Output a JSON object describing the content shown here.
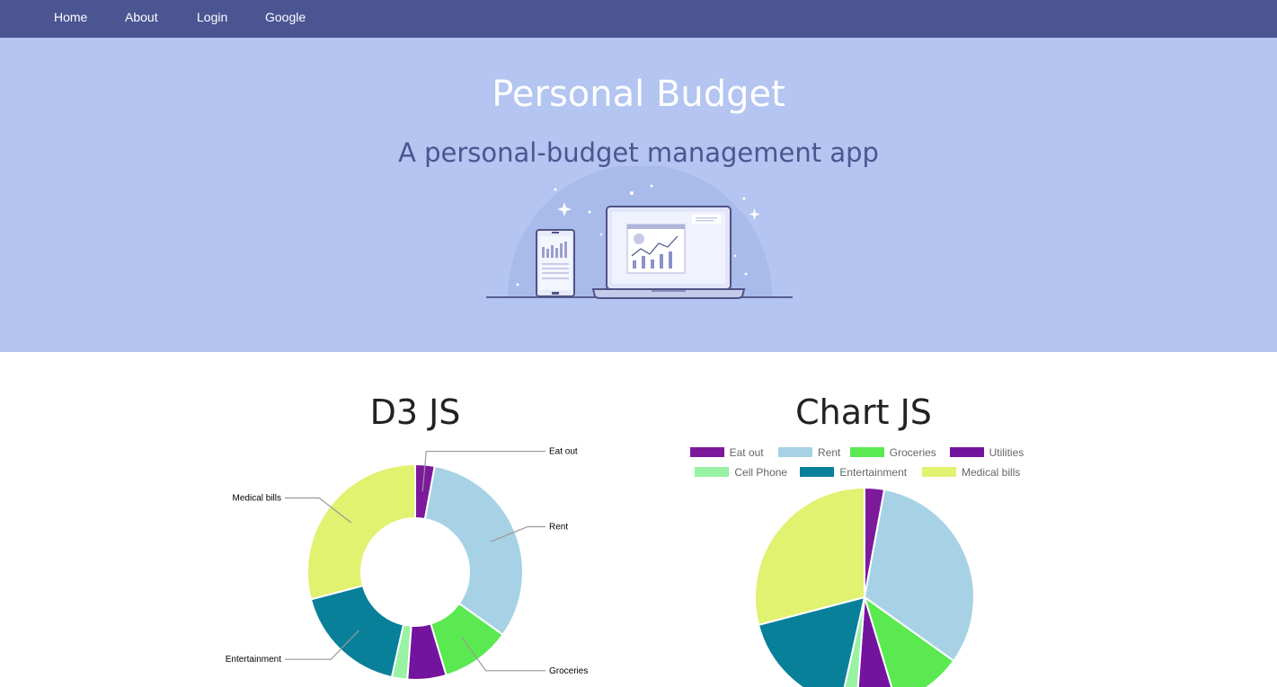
{
  "nav": {
    "items": [
      "Home",
      "About",
      "Login",
      "Google"
    ]
  },
  "hero": {
    "title": "Personal Budget",
    "subtitle": "A personal-budget management app",
    "illustration_icon": "devices-chart-illustration"
  },
  "colors": {
    "nav_bg": "#4b5592",
    "hero_bg": "#b3c5f0",
    "eat_out": "#7c1a9b",
    "rent": "#a7d2e6",
    "groceries": "#5ae950",
    "utilities": "#73149f",
    "cell_phone": "#97f2a4",
    "entertainment": "#08809a",
    "medical_bills": "#e1f170"
  },
  "d3_section": {
    "title": "D3 JS"
  },
  "chartjs_section": {
    "title": "Chart JS"
  },
  "chart_data": [
    {
      "type": "pie",
      "variant": "donut",
      "categories": [
        "Eat out",
        "Rent",
        "Groceries",
        "Utilities",
        "Cell Phone",
        "Entertainment",
        "Medical bills"
      ],
      "values": [
        25,
        275,
        90,
        50,
        20,
        150,
        250
      ],
      "visible_labels": [
        "Eat out",
        "Rent",
        "Groceries",
        "Entertainment",
        "Medical bills"
      ],
      "title": ""
    },
    {
      "type": "pie",
      "categories": [
        "Eat out",
        "Rent",
        "Groceries",
        "Utilities",
        "Cell Phone",
        "Entertainment",
        "Medical bills"
      ],
      "values": [
        25,
        275,
        90,
        50,
        20,
        150,
        250
      ],
      "legend": "top",
      "title": ""
    }
  ]
}
